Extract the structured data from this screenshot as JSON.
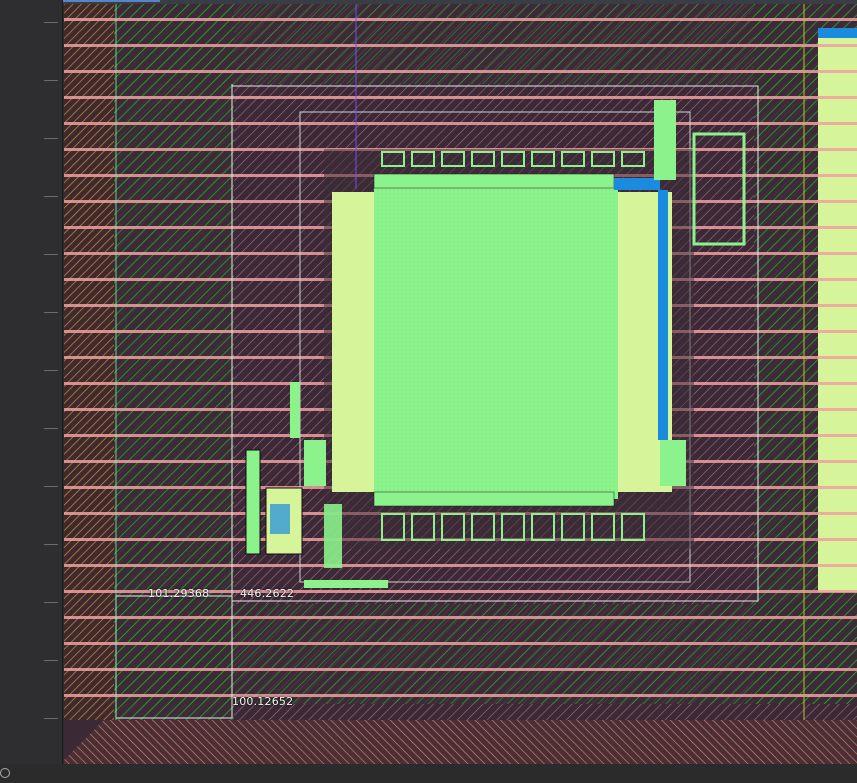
{
  "window": {
    "title": ""
  },
  "canvas": {
    "background": "#3b2a36",
    "colors": {
      "metal_pink": "#e07f7f",
      "metal_green": "#33aa33",
      "active_green": "#8cf28c",
      "pale_yellow_green": "#d9f59a",
      "blue_via": "#1b8be0",
      "outline_white": "#f0f0f0",
      "hatch_orange": "#cf8b40"
    }
  },
  "annotations": {
    "coord_top_left": "101.29368",
    "coord_top_right": "446.2622",
    "coord_bottom": "100.12652"
  },
  "ruler": {
    "icon": "ruler-icon"
  }
}
